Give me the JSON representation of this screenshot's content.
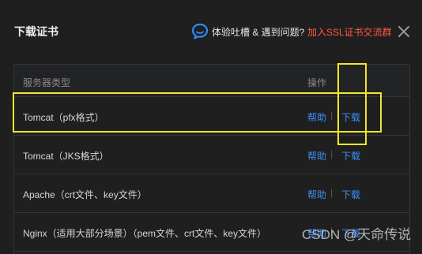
{
  "dialog": {
    "title": "下载证书",
    "feedback_text": "体验吐槽 & 遇到问题?",
    "join_link": "加入SSL证书交流群",
    "icons": {
      "feedback": "chat-bubble-icon",
      "close": "close-icon"
    }
  },
  "table": {
    "headers": {
      "type": "服务器类型",
      "op": "操作"
    },
    "rows": [
      {
        "name": "Tomcat（pfx格式）",
        "help": "帮助",
        "sep": "|",
        "download": "下载"
      },
      {
        "name": "Tomcat（JKS格式）",
        "help": "帮助",
        "sep": "|",
        "download": "下载"
      },
      {
        "name": "Apache（crt文件、key文件）",
        "help": "帮助",
        "sep": "|",
        "download": "下载"
      },
      {
        "name": "Nginx（适用大部分场景）（pem文件、crt文件、key文件）",
        "help": "帮助",
        "sep": "|",
        "download": "下载"
      }
    ]
  },
  "watermark": "CSDN @天命传说",
  "colors": {
    "background": "#1f1f20",
    "link": "#3b8ff6",
    "accent_link": "#ff5a3c",
    "highlight": "#f5e627",
    "border": "#333436"
  }
}
